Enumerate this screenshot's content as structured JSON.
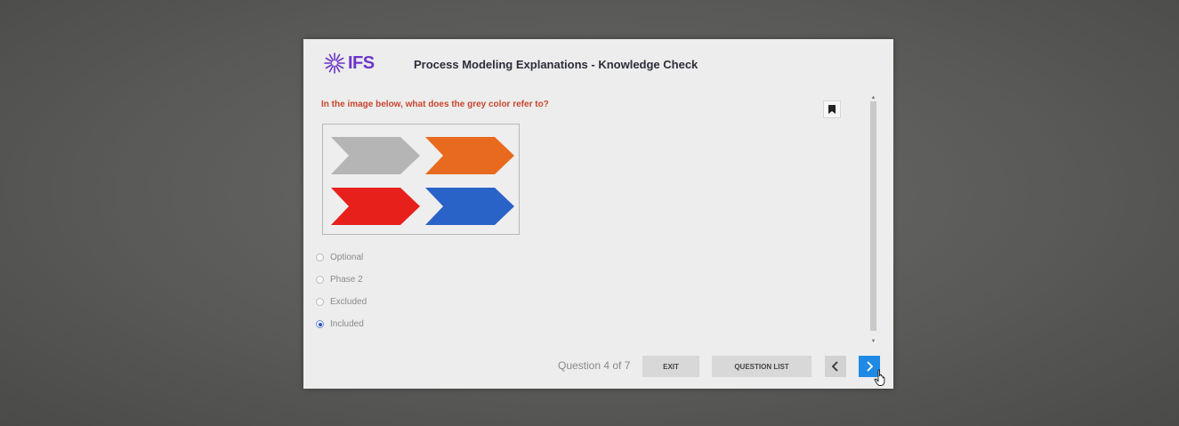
{
  "header": {
    "logo_text": "IFS",
    "logo_icon": "ifs-sunburst-icon",
    "course_title": "Process Modeling Explanations - Knowledge Check"
  },
  "question": {
    "text": "In the image below, what does the grey color refer to?",
    "bookmark_icon": "bookmark-icon",
    "options": [
      {
        "label": "Optional",
        "selected": false
      },
      {
        "label": "Phase 2",
        "selected": false
      },
      {
        "label": "Excluded",
        "selected": false
      },
      {
        "label": "Included",
        "selected": true
      }
    ]
  },
  "image": {
    "arrows": [
      {
        "color": "#b5b5b5",
        "row": 0,
        "col": 0
      },
      {
        "color": "#e86a1e",
        "row": 0,
        "col": 1
      },
      {
        "color": "#e8201c",
        "row": 1,
        "col": 0
      },
      {
        "color": "#2a63c8",
        "row": 1,
        "col": 1
      }
    ]
  },
  "footer": {
    "progress": "Question 4 of 7",
    "exit_label": "EXIT",
    "question_list_label": "QUESTION LIST",
    "prev_icon": "chevron-left-icon",
    "next_icon": "chevron-right-icon"
  },
  "colors": {
    "brand_purple": "#6c35c9",
    "question_red": "#c8452e",
    "next_blue": "#1f8ae6",
    "selected_radio": "#2a55c5"
  }
}
